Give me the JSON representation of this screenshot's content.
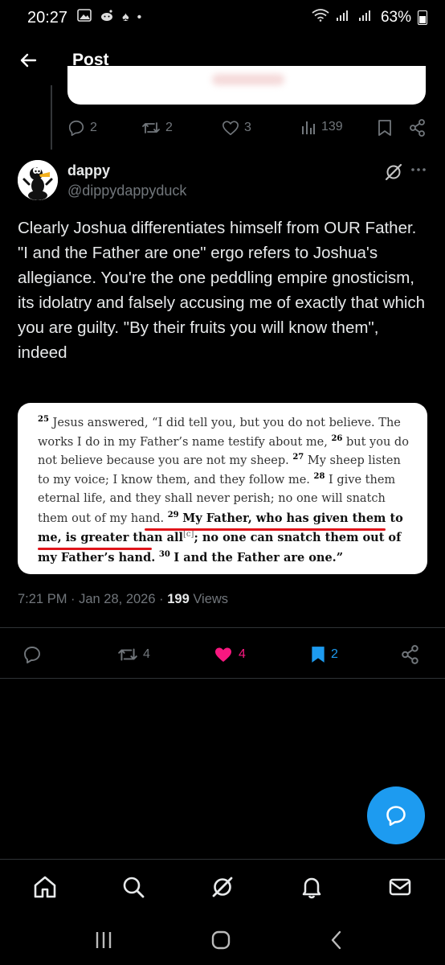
{
  "status_bar": {
    "time": "20:27",
    "battery": "63%",
    "dot": "•"
  },
  "header": {
    "title": "Post"
  },
  "previous_post_actions": {
    "replies": "2",
    "reposts": "2",
    "likes": "3",
    "views": "139"
  },
  "post": {
    "display_name": "dappy",
    "handle": "@dippydappyduck",
    "text": "Clearly Joshua differentiates himself from OUR Father.\n\"I and the Father are one\" ergo refers to Joshua's allegiance. You're the one peddling empire gnosticism, its idolatry and falsely accusing me of exactly that which you are guilty. \"By their fruits you will know them\", indeed",
    "time": "7:21 PM",
    "date": "Jan 28, 2026",
    "views_count": "199",
    "views_label": "Views",
    "replies": "",
    "reposts": "4",
    "likes": "4",
    "bookmarks": "2"
  },
  "quote_image": {
    "v25": "25",
    "t25": "Jesus answered, “I did tell you, but you do not believe. The works I do in my Father’s name testify about me,",
    "v26": "26",
    "t26": "but you do not believe because you are not my sheep.",
    "v27": "27",
    "t27": "My sheep listen to my voice; I know them, and they follow me.",
    "v28": "28",
    "t28": "I give them eternal life, and they shall never perish; no one will snatch them out of my hand.",
    "v29": "29",
    "t29_bold": "My Father, who has given them to me, is greater than all",
    "footnote": "[c]",
    "t29_rest": "; no one can snatch them out of my Father’s hand.",
    "v30": "30",
    "t30": "I and the Father are one.”"
  },
  "colors": {
    "background": "#000000",
    "accent": "#1d9bf0",
    "like": "#f91880",
    "underline": "#e0151b",
    "muted": "#71767b"
  }
}
